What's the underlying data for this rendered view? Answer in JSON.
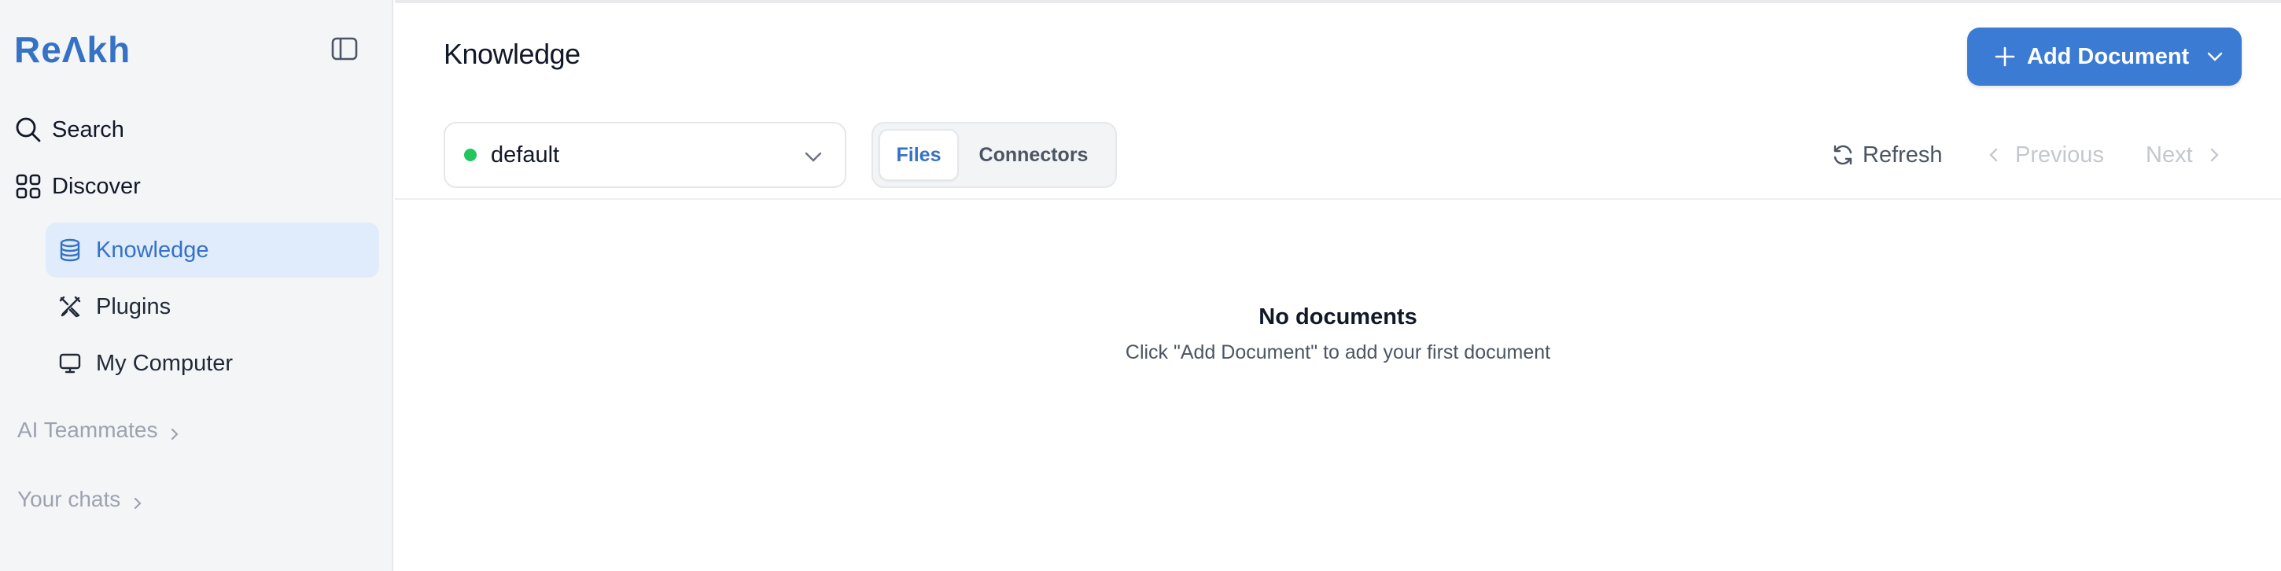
{
  "app": {
    "logo_text": "ReΛkh"
  },
  "sidebar": {
    "search_label": "Search",
    "discover_label": "Discover",
    "discover_items": [
      {
        "label": "Knowledge",
        "icon": "database-icon",
        "active": true
      },
      {
        "label": "Plugins",
        "icon": "tools-icon",
        "active": false
      },
      {
        "label": "My Computer",
        "icon": "monitor-icon",
        "active": false
      }
    ],
    "sections": [
      {
        "label": "AI Teammates"
      },
      {
        "label": "Your chats"
      }
    ]
  },
  "header": {
    "title": "Knowledge",
    "add_document_label": "Add Document"
  },
  "toolbar": {
    "knowledge_base": {
      "value": "default",
      "status_color": "#22c55e"
    },
    "tabs": [
      {
        "label": "Files",
        "selected": true
      },
      {
        "label": "Connectors",
        "selected": false
      }
    ],
    "refresh_label": "Refresh",
    "previous_label": "Previous",
    "next_label": "Next"
  },
  "empty_state": {
    "title": "No documents",
    "subtitle": "Click \"Add Document\" to add your first document"
  },
  "colors": {
    "accent": "#3572c6",
    "button": "#3b7bd4",
    "active_bg": "#e0ebfb",
    "sidebar_bg": "#f4f5f7"
  }
}
